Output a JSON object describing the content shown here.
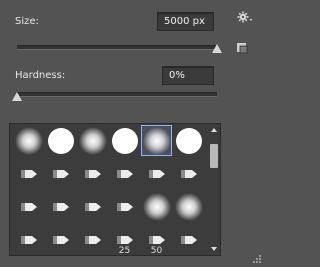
{
  "size": {
    "label": "Size:",
    "value": "5000 px",
    "slider_fraction": 1.0
  },
  "hardness": {
    "label": "Hardness:",
    "value": "0%",
    "slider_fraction": 0.0
  },
  "presets": [
    {
      "kind": "soft-round"
    },
    {
      "kind": "hard-round"
    },
    {
      "kind": "soft-round"
    },
    {
      "kind": "hard-round"
    },
    {
      "kind": "soft-round",
      "selected": true
    },
    {
      "kind": "hard-round"
    },
    {
      "kind": "stroke"
    },
    {
      "kind": "stroke"
    },
    {
      "kind": "stroke"
    },
    {
      "kind": "stroke"
    },
    {
      "kind": "stroke"
    },
    {
      "kind": "stroke"
    },
    {
      "kind": "stroke"
    },
    {
      "kind": "stroke"
    },
    {
      "kind": "stroke"
    },
    {
      "kind": "stroke"
    },
    {
      "kind": "soft-round"
    },
    {
      "kind": "soft-round"
    },
    {
      "kind": "stroke"
    },
    {
      "kind": "stroke"
    },
    {
      "kind": "stroke"
    },
    {
      "kind": "stroke",
      "size_label": "25"
    },
    {
      "kind": "stroke",
      "size_label": "50"
    },
    {
      "kind": "stroke"
    }
  ],
  "icons": {
    "gear": "gear-icon",
    "new_preset": "new-preset-icon"
  },
  "colors": {
    "selection": "#8cb4ff"
  }
}
